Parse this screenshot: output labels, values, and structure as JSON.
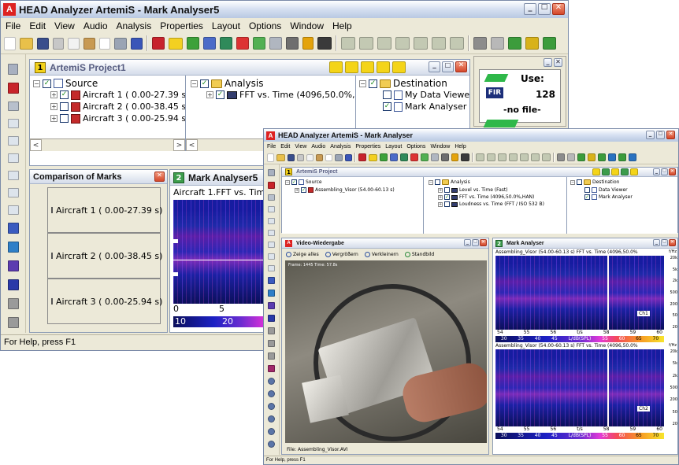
{
  "back": {
    "title": "HEAD Analyzer ArtemiS - Mark Analyser5",
    "menu": [
      "File",
      "Edit",
      "View",
      "Audio",
      "Analysis",
      "Properties",
      "Layout",
      "Options",
      "Window",
      "Help"
    ],
    "project": {
      "number": "1",
      "title": "ArtemiS Project1",
      "source_label": "Source",
      "source_items": [
        "Aircraft 1  ( 0.00-27.39 s)",
        "Aircraft 2 ( 0.00-38.45 s)",
        "Aircraft 3 ( 0.00-25.94 s)"
      ],
      "analysis_label": "Analysis",
      "analysis_items": [
        "FFT vs. Time (4096,50.0%,HAN)"
      ],
      "destination_label": "Destination",
      "destination_items": [
        "My Data Viewer",
        "Mark Analyser"
      ]
    },
    "player": {
      "use_label": "Use:",
      "use_value": "128",
      "fir_label": "FIR",
      "file_label": "-no file-"
    },
    "comparison": {
      "title": "Comparison of Marks",
      "rows": [
        "Aircraft 1  ( 0.00-27.39 s)",
        "Aircraft 2 ( 0.00-38.45 s)",
        "Aircraft 3 ( 0.00-25.94 s)"
      ]
    },
    "mark_analyser": {
      "number": "2",
      "title": "Mark Analyser5",
      "subtitle": "Aircraft 1.FFT vs. Time",
      "axis_ticks": [
        "0",
        "5"
      ],
      "scale_ticks": [
        "10",
        "20"
      ]
    },
    "status": "For Help, press F1"
  },
  "front": {
    "title": "HEAD Analyzer ArtemiS - Mark Analyser",
    "menu": [
      "File",
      "Edit",
      "View",
      "Audio",
      "Analysis",
      "Properties",
      "Layout",
      "Options",
      "Window",
      "Help"
    ],
    "project": {
      "number": "1",
      "title": "ArtemiS Project",
      "source_label": "Source",
      "source_items": [
        "Assembling_Visor (54.00-60.13 s)"
      ],
      "analysis_label": "Analysis",
      "analysis_items": [
        "Level vs. Time (Fast)",
        "FFT vs. Time (4096,50.0%,HAN)",
        "Loudness vs. Time (FFT / ISO 532 B)"
      ],
      "destination_label": "Destination",
      "destination_items": [
        "Data Viewer",
        "Mark Analyser"
      ]
    },
    "video": {
      "title": "Video-Wiedergabe",
      "toolbar": [
        "Zeige alles",
        "Vergrößern",
        "Verkleinern",
        "Standbild"
      ],
      "frame_label": "Frame: 1445 Time: 57.8s",
      "file_label": "File: Assembling_Visor.AVI"
    },
    "mark_analyser": {
      "number": "2",
      "title": "Mark Analyser",
      "ch1_title": "Assembling_Visor (54.00-60.13 s) FFT vs. Time (4096,50.0%",
      "ch2_title": "Assembling_Visor (54.00-60.13 s) FFT vs. Time (4096,50.0%",
      "ch1_tag": "Ch1",
      "ch2_tag": "Ch2",
      "freq_unit": "f/Hz",
      "freq_ticks": [
        "20k",
        "5k",
        "2k",
        "500",
        "200",
        "50",
        "20"
      ],
      "time_ticks": [
        "54",
        "55",
        "56",
        "t/s",
        "58",
        "59",
        "60"
      ],
      "scale_ticks": [
        "30",
        "35",
        "40",
        "45",
        "L/dB(SPL)",
        "55",
        "60",
        "65",
        "70"
      ]
    },
    "status": "For Help, press F1"
  },
  "colors": {
    "spectrogram_base": "#161ca0",
    "spectrogram_hot": "#ff50d2",
    "accent_green": "#2fb84a",
    "artemis_red": "#d22222"
  }
}
